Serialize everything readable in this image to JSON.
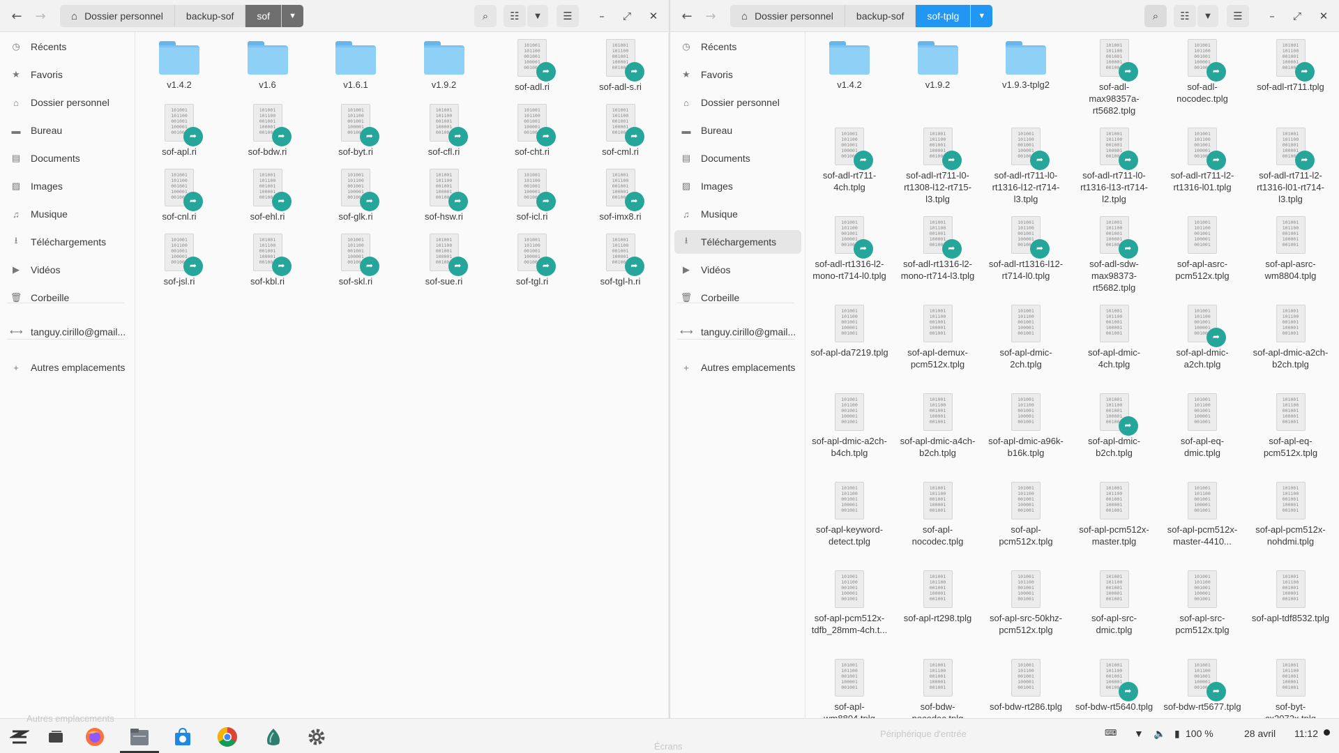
{
  "colors": {
    "accent": "#2196f3",
    "link_badge": "#26a69a",
    "folder": "#8fd0f7",
    "active_crumb_left": "#6f6f6f"
  },
  "left": {
    "path": [
      "Dossier personnel",
      "backup-sof",
      "sof"
    ],
    "sidebar": [
      "Récents",
      "Favoris",
      "Dossier personnel",
      "Bureau",
      "Documents",
      "Images",
      "Musique",
      "Téléchargements",
      "Vidéos",
      "Corbeille",
      "tanguy.cirillo@gmail...",
      "Autres emplacements"
    ],
    "files": [
      {
        "name": "v1.4.2",
        "type": "folder"
      },
      {
        "name": "v1.6",
        "type": "folder"
      },
      {
        "name": "v1.6.1",
        "type": "folder"
      },
      {
        "name": "v1.9.2",
        "type": "folder"
      },
      {
        "name": "sof-adl.ri",
        "type": "link"
      },
      {
        "name": "sof-adl-s.ri",
        "type": "link"
      },
      {
        "name": "sof-apl.ri",
        "type": "link"
      },
      {
        "name": "sof-bdw.ri",
        "type": "link"
      },
      {
        "name": "sof-byt.ri",
        "type": "link"
      },
      {
        "name": "sof-cfl.ri",
        "type": "link"
      },
      {
        "name": "sof-cht.ri",
        "type": "link"
      },
      {
        "name": "sof-cml.ri",
        "type": "link"
      },
      {
        "name": "sof-cnl.ri",
        "type": "link"
      },
      {
        "name": "sof-ehl.ri",
        "type": "link"
      },
      {
        "name": "sof-glk.ri",
        "type": "link"
      },
      {
        "name": "sof-hsw.ri",
        "type": "link"
      },
      {
        "name": "sof-icl.ri",
        "type": "link"
      },
      {
        "name": "sof-imx8.ri",
        "type": "link"
      },
      {
        "name": "sof-jsl.ri",
        "type": "link"
      },
      {
        "name": "sof-kbl.ri",
        "type": "link"
      },
      {
        "name": "sof-skl.ri",
        "type": "link"
      },
      {
        "name": "sof-sue.ri",
        "type": "link"
      },
      {
        "name": "sof-tgl.ri",
        "type": "link"
      },
      {
        "name": "sof-tgl-h.ri",
        "type": "link"
      }
    ]
  },
  "right": {
    "path": [
      "Dossier personnel",
      "backup-sof",
      "sof-tplg"
    ],
    "sidebar": [
      "Récents",
      "Favoris",
      "Dossier personnel",
      "Bureau",
      "Documents",
      "Images",
      "Musique",
      "Téléchargements",
      "Vidéos",
      "Corbeille",
      "tanguy.cirillo@gmail...",
      "Autres emplacements"
    ],
    "active_sidebar": "Téléchargements",
    "files": [
      {
        "name": "v1.4.2",
        "type": "folder"
      },
      {
        "name": "v1.9.2",
        "type": "folder"
      },
      {
        "name": "v1.9.3-tplg2",
        "type": "folder"
      },
      {
        "name": "sof-adl-max98357a-rt5682.tplg",
        "type": "link"
      },
      {
        "name": "sof-adl-nocodec.tplg",
        "type": "link"
      },
      {
        "name": "sof-adl-rt711.tplg",
        "type": "link"
      },
      {
        "name": "sof-adl-rt711-4ch.tplg",
        "type": "link"
      },
      {
        "name": "sof-adl-rt711-l0-rt1308-l12-rt715-l3.tplg",
        "type": "link"
      },
      {
        "name": "sof-adl-rt711-l0-rt1316-l12-rt714-l3.tplg",
        "type": "link"
      },
      {
        "name": "sof-adl-rt711-l0-rt1316-l13-rt714-l2.tplg",
        "type": "link"
      },
      {
        "name": "sof-adl-rt711-l2-rt1316-l01.tplg",
        "type": "link"
      },
      {
        "name": "sof-adl-rt711-l2-rt1316-l01-rt714-l3.tplg",
        "type": "link"
      },
      {
        "name": "sof-adl-rt1316-l2-mono-rt714-l0.tplg",
        "type": "link"
      },
      {
        "name": "sof-adl-rt1316-l2-mono-rt714-l3.tplg",
        "type": "link"
      },
      {
        "name": "sof-adl-rt1316-l12-rt714-l0.tplg",
        "type": "link"
      },
      {
        "name": "sof-adl-sdw-max98373-rt5682.tplg",
        "type": "link"
      },
      {
        "name": "sof-apl-asrc-pcm512x.tplg",
        "type": "file"
      },
      {
        "name": "sof-apl-asrc-wm8804.tplg",
        "type": "file"
      },
      {
        "name": "sof-apl-da7219.tplg",
        "type": "file"
      },
      {
        "name": "sof-apl-demux-pcm512x.tplg",
        "type": "file"
      },
      {
        "name": "sof-apl-dmic-2ch.tplg",
        "type": "file"
      },
      {
        "name": "sof-apl-dmic-4ch.tplg",
        "type": "file"
      },
      {
        "name": "sof-apl-dmic-a2ch.tplg",
        "type": "link"
      },
      {
        "name": "sof-apl-dmic-a2ch-b2ch.tplg",
        "type": "file"
      },
      {
        "name": "sof-apl-dmic-a2ch-b4ch.tplg",
        "type": "file"
      },
      {
        "name": "sof-apl-dmic-a4ch-b2ch.tplg",
        "type": "file"
      },
      {
        "name": "sof-apl-dmic-a96k-b16k.tplg",
        "type": "file"
      },
      {
        "name": "sof-apl-dmic-b2ch.tplg",
        "type": "link"
      },
      {
        "name": "sof-apl-eq-dmic.tplg",
        "type": "file"
      },
      {
        "name": "sof-apl-eq-pcm512x.tplg",
        "type": "file"
      },
      {
        "name": "sof-apl-keyword-detect.tplg",
        "type": "file"
      },
      {
        "name": "sof-apl-nocodec.tplg",
        "type": "file"
      },
      {
        "name": "sof-apl-pcm512x.tplg",
        "type": "file"
      },
      {
        "name": "sof-apl-pcm512x-master.tplg",
        "type": "file"
      },
      {
        "name": "sof-apl-pcm512x-master-4410...",
        "type": "file"
      },
      {
        "name": "sof-apl-pcm512x-nohdmi.tplg",
        "type": "file"
      },
      {
        "name": "sof-apl-pcm512x-tdfb_28mm-4ch.t...",
        "type": "file"
      },
      {
        "name": "sof-apl-rt298.tplg",
        "type": "file"
      },
      {
        "name": "sof-apl-src-50khz-pcm512x.tplg",
        "type": "file"
      },
      {
        "name": "sof-apl-src-dmic.tplg",
        "type": "file"
      },
      {
        "name": "sof-apl-src-pcm512x.tplg",
        "type": "file"
      },
      {
        "name": "sof-apl-tdf8532.tplg",
        "type": "file"
      },
      {
        "name": "sof-apl-wm8804.tplg",
        "type": "file"
      },
      {
        "name": "sof-bdw-nocodec.tplg",
        "type": "file"
      },
      {
        "name": "sof-bdw-rt286.tplg",
        "type": "file"
      },
      {
        "name": "sof-bdw-rt5640.tplg",
        "type": "link"
      },
      {
        "name": "sof-bdw-rt5677.tplg",
        "type": "link"
      },
      {
        "name": "sof-byt-cx2072x.tplg",
        "type": "file"
      }
    ]
  },
  "taskbar": {
    "ghost_left": "Autres emplacements",
    "ghost_input": "Périphérique d'entrée",
    "ghost_screens": "Écrans",
    "battery": "100 %",
    "date": "28 avril",
    "time": "11:12"
  }
}
